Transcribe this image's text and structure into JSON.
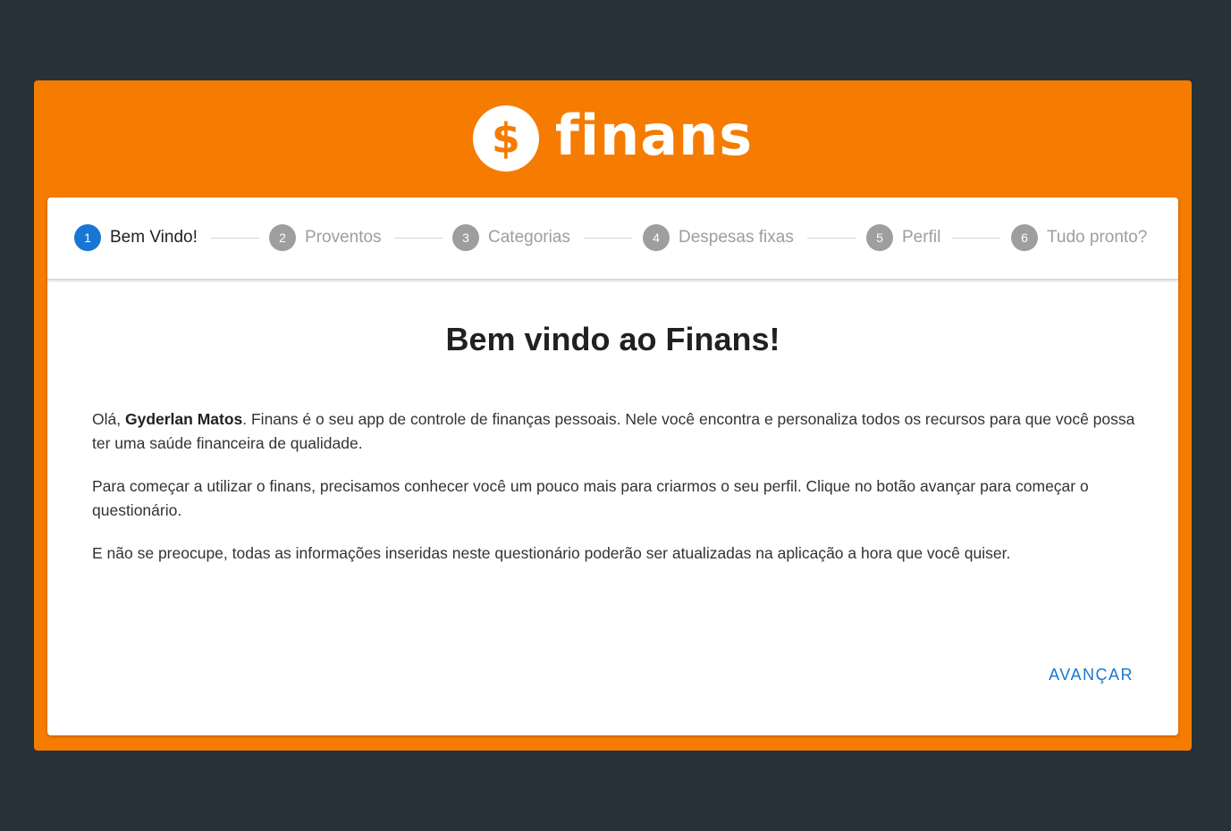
{
  "brand": {
    "logo_symbol": "$",
    "logo_text": "finans",
    "color": "#f57c00"
  },
  "stepper": {
    "steps": [
      {
        "number": "1",
        "label": "Bem Vindo!"
      },
      {
        "number": "2",
        "label": "Proventos"
      },
      {
        "number": "3",
        "label": "Categorias"
      },
      {
        "number": "4",
        "label": "Despesas fixas"
      },
      {
        "number": "5",
        "label": "Perfil"
      },
      {
        "number": "6",
        "label": "Tudo pronto?"
      }
    ],
    "active_step": 1,
    "active_color": "#1976d2"
  },
  "content": {
    "title": "Bem vindo ao Finans!",
    "greeting": "Olá, ",
    "user_name": "Gyderlan Matos",
    "intro_text": ". Finans é o seu app de controle de finanças pessoais. Nele você encontra e personaliza todos os recursos para que você possa ter uma saúde financeira de qualidade.",
    "paragraph_2": "Para começar a utilizar o finans, precisamos conhecer você um pouco mais para criarmos o seu perfil. Clique no botão avançar para começar o questionário.",
    "paragraph_3": "E não se preocupe, todas as informações inseridas neste questionário poderão ser atualizadas na aplicação a hora que você quiser."
  },
  "actions": {
    "next_label": "AVANÇAR"
  }
}
